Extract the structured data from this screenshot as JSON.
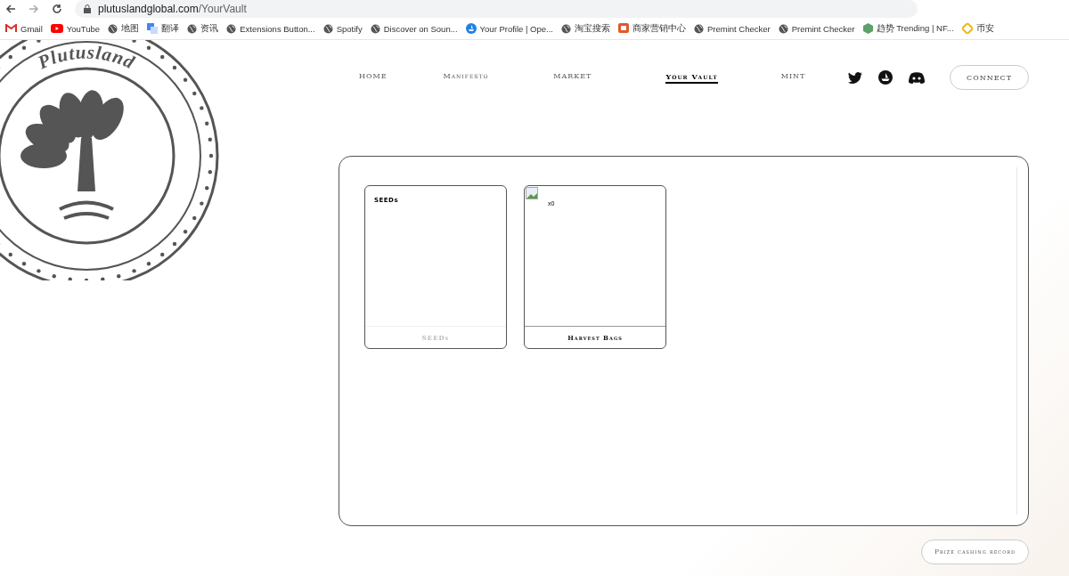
{
  "browser": {
    "url_host": "plutuslandglobal.com",
    "url_path": "/YourVault",
    "bookmarks": [
      {
        "label": "Gmail",
        "kind": "gmail"
      },
      {
        "label": "YouTube",
        "kind": "youtube"
      },
      {
        "label": "地图",
        "kind": "globe"
      },
      {
        "label": "翻译",
        "kind": "translate"
      },
      {
        "label": "资讯",
        "kind": "globe"
      },
      {
        "label": "Extensions Button...",
        "kind": "globe"
      },
      {
        "label": "Spotify",
        "kind": "globe"
      },
      {
        "label": "Discover on Soun...",
        "kind": "globe"
      },
      {
        "label": "Your Profile | Ope...",
        "kind": "boat"
      },
      {
        "label": "淘宝搜索",
        "kind": "globe"
      },
      {
        "label": "商家营销中心",
        "kind": "shop"
      },
      {
        "label": "Premint Checker",
        "kind": "globe"
      },
      {
        "label": "Premint Checker",
        "kind": "globe"
      },
      {
        "label": "趋势 Trending | NF...",
        "kind": "hex"
      },
      {
        "label": "币安",
        "kind": "diamond"
      }
    ]
  },
  "logo": {
    "text": "Plutusland"
  },
  "nav": [
    {
      "label": "HOME",
      "selected": false
    },
    {
      "label": "Manifesto",
      "selected": false
    },
    {
      "label": "MARKET",
      "selected": false
    },
    {
      "label": "Your Vault",
      "selected": true
    },
    {
      "label": "MINT",
      "selected": false
    }
  ],
  "connect_button": "CONNECT",
  "vault_cards": [
    {
      "title": "SEEDs",
      "footer": "SEEDs",
      "image": false,
      "dimmed": true
    },
    {
      "count": "x0",
      "footer": "Harvest Bags",
      "image": true,
      "dimmed": false
    }
  ],
  "prize_button": "Prize cashing record"
}
